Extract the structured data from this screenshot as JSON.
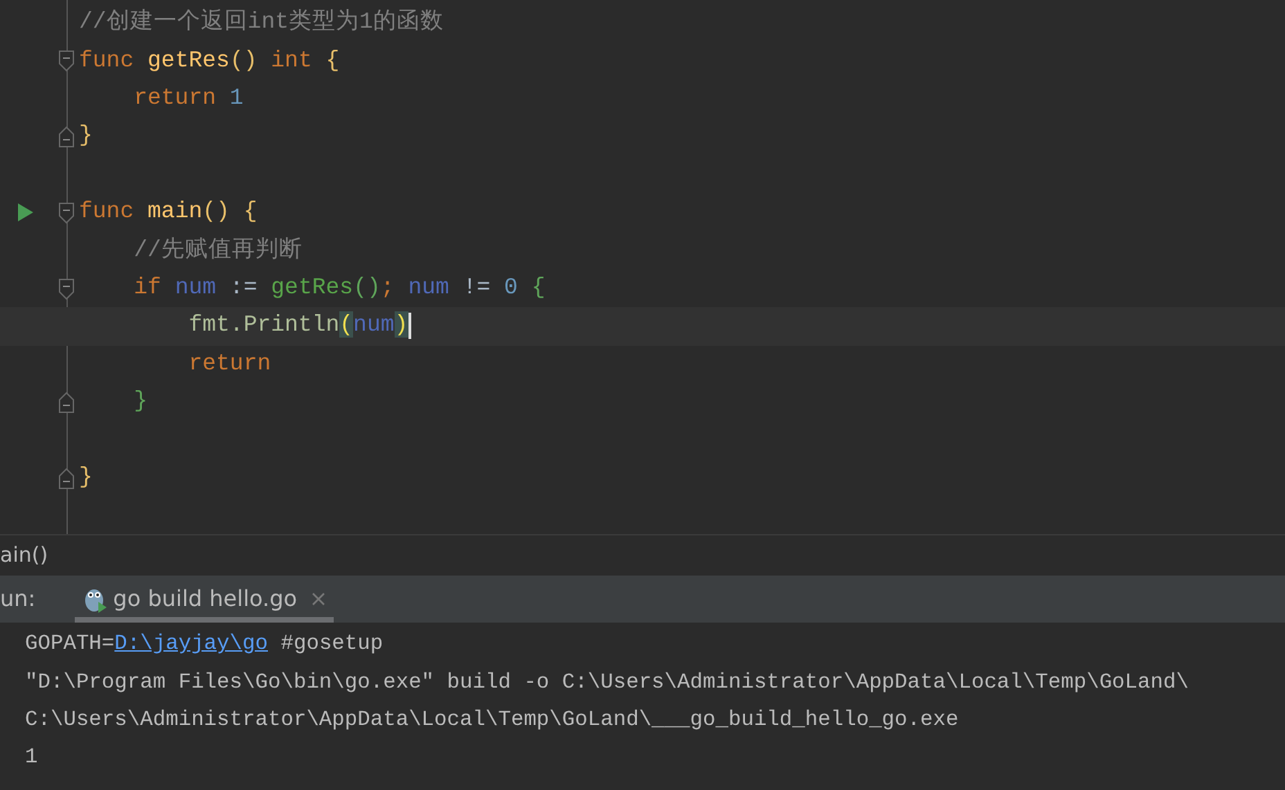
{
  "editor": {
    "lines": [
      {
        "tokens": [
          {
            "text": "//创建一个返回int类型为1的函数",
            "kind": "comment"
          }
        ]
      },
      {
        "fold_start": true,
        "tokens": [
          {
            "text": "func ",
            "kind": "keyword"
          },
          {
            "text": "getRes",
            "kind": "funcname"
          },
          {
            "text": "() ",
            "kind": "brace1"
          },
          {
            "text": "int ",
            "kind": "keyword"
          },
          {
            "text": "{",
            "kind": "brace1"
          }
        ]
      },
      {
        "tokens": [
          {
            "text": "    return ",
            "kind": "keyword"
          },
          {
            "text": "1",
            "kind": "number"
          }
        ]
      },
      {
        "fold_end": true,
        "tokens": [
          {
            "text": "}",
            "kind": "brace1"
          }
        ]
      },
      {
        "space_before": true,
        "fold_start": true,
        "run": true,
        "tokens": [
          {
            "text": "func ",
            "kind": "keyword"
          },
          {
            "text": "main",
            "kind": "funcname"
          },
          {
            "text": "() ",
            "kind": "brace1"
          },
          {
            "text": "{",
            "kind": "brace1"
          }
        ]
      },
      {
        "tokens": [
          {
            "text": "    //先赋值再判断",
            "kind": "comment"
          }
        ]
      },
      {
        "fold_start": true,
        "tokens": [
          {
            "text": "    if ",
            "kind": "keyword"
          },
          {
            "text": "num ",
            "kind": "var"
          },
          {
            "text": ":= ",
            "kind": "plain"
          },
          {
            "text": "getRes",
            "kind": "call"
          },
          {
            "text": "()",
            "kind": "brace2"
          },
          {
            "text": "; ",
            "kind": "keyword"
          },
          {
            "text": "num ",
            "kind": "var"
          },
          {
            "text": "!= ",
            "kind": "plain"
          },
          {
            "text": "0 ",
            "kind": "number"
          },
          {
            "text": "{",
            "kind": "brace2"
          }
        ]
      },
      {
        "current": true,
        "caret": true,
        "tokens": [
          {
            "text": "        fmt.Println",
            "kind": "pkg"
          },
          {
            "text": "(",
            "kind": "match"
          },
          {
            "text": "num",
            "kind": "var"
          },
          {
            "text": ")",
            "kind": "match"
          }
        ]
      },
      {
        "tokens": [
          {
            "text": "        return",
            "kind": "keyword"
          }
        ]
      },
      {
        "fold_end": true,
        "tokens": [
          {
            "text": "    }",
            "kind": "brace2"
          }
        ]
      },
      {
        "space_before": true,
        "fold_end": true,
        "tokens": [
          {
            "text": "}",
            "kind": "brace1"
          }
        ]
      }
    ]
  },
  "breadcrumb": "ain()",
  "run_panel": {
    "label": "un:",
    "tabs": [
      {
        "title": "go build hello.go",
        "selected": true
      }
    ],
    "console": [
      {
        "parts": [
          {
            "text": "GOPATH=",
            "kind": "text"
          },
          {
            "text": "D:\\jayjay\\go",
            "kind": "link"
          },
          {
            "text": " #gosetup",
            "kind": "text"
          }
        ]
      },
      {
        "parts": [
          {
            "text": "\"D:\\Program Files\\Go\\bin\\go.exe\" build -o C:\\Users\\Administrator\\AppData\\Local\\Temp\\GoLand\\",
            "kind": "text"
          }
        ]
      },
      {
        "parts": [
          {
            "text": "C:\\Users\\Administrator\\AppData\\Local\\Temp\\GoLand\\___go_build_hello_go.exe",
            "kind": "text"
          }
        ]
      },
      {
        "parts": [
          {
            "text": "1",
            "kind": "text"
          }
        ]
      }
    ]
  }
}
